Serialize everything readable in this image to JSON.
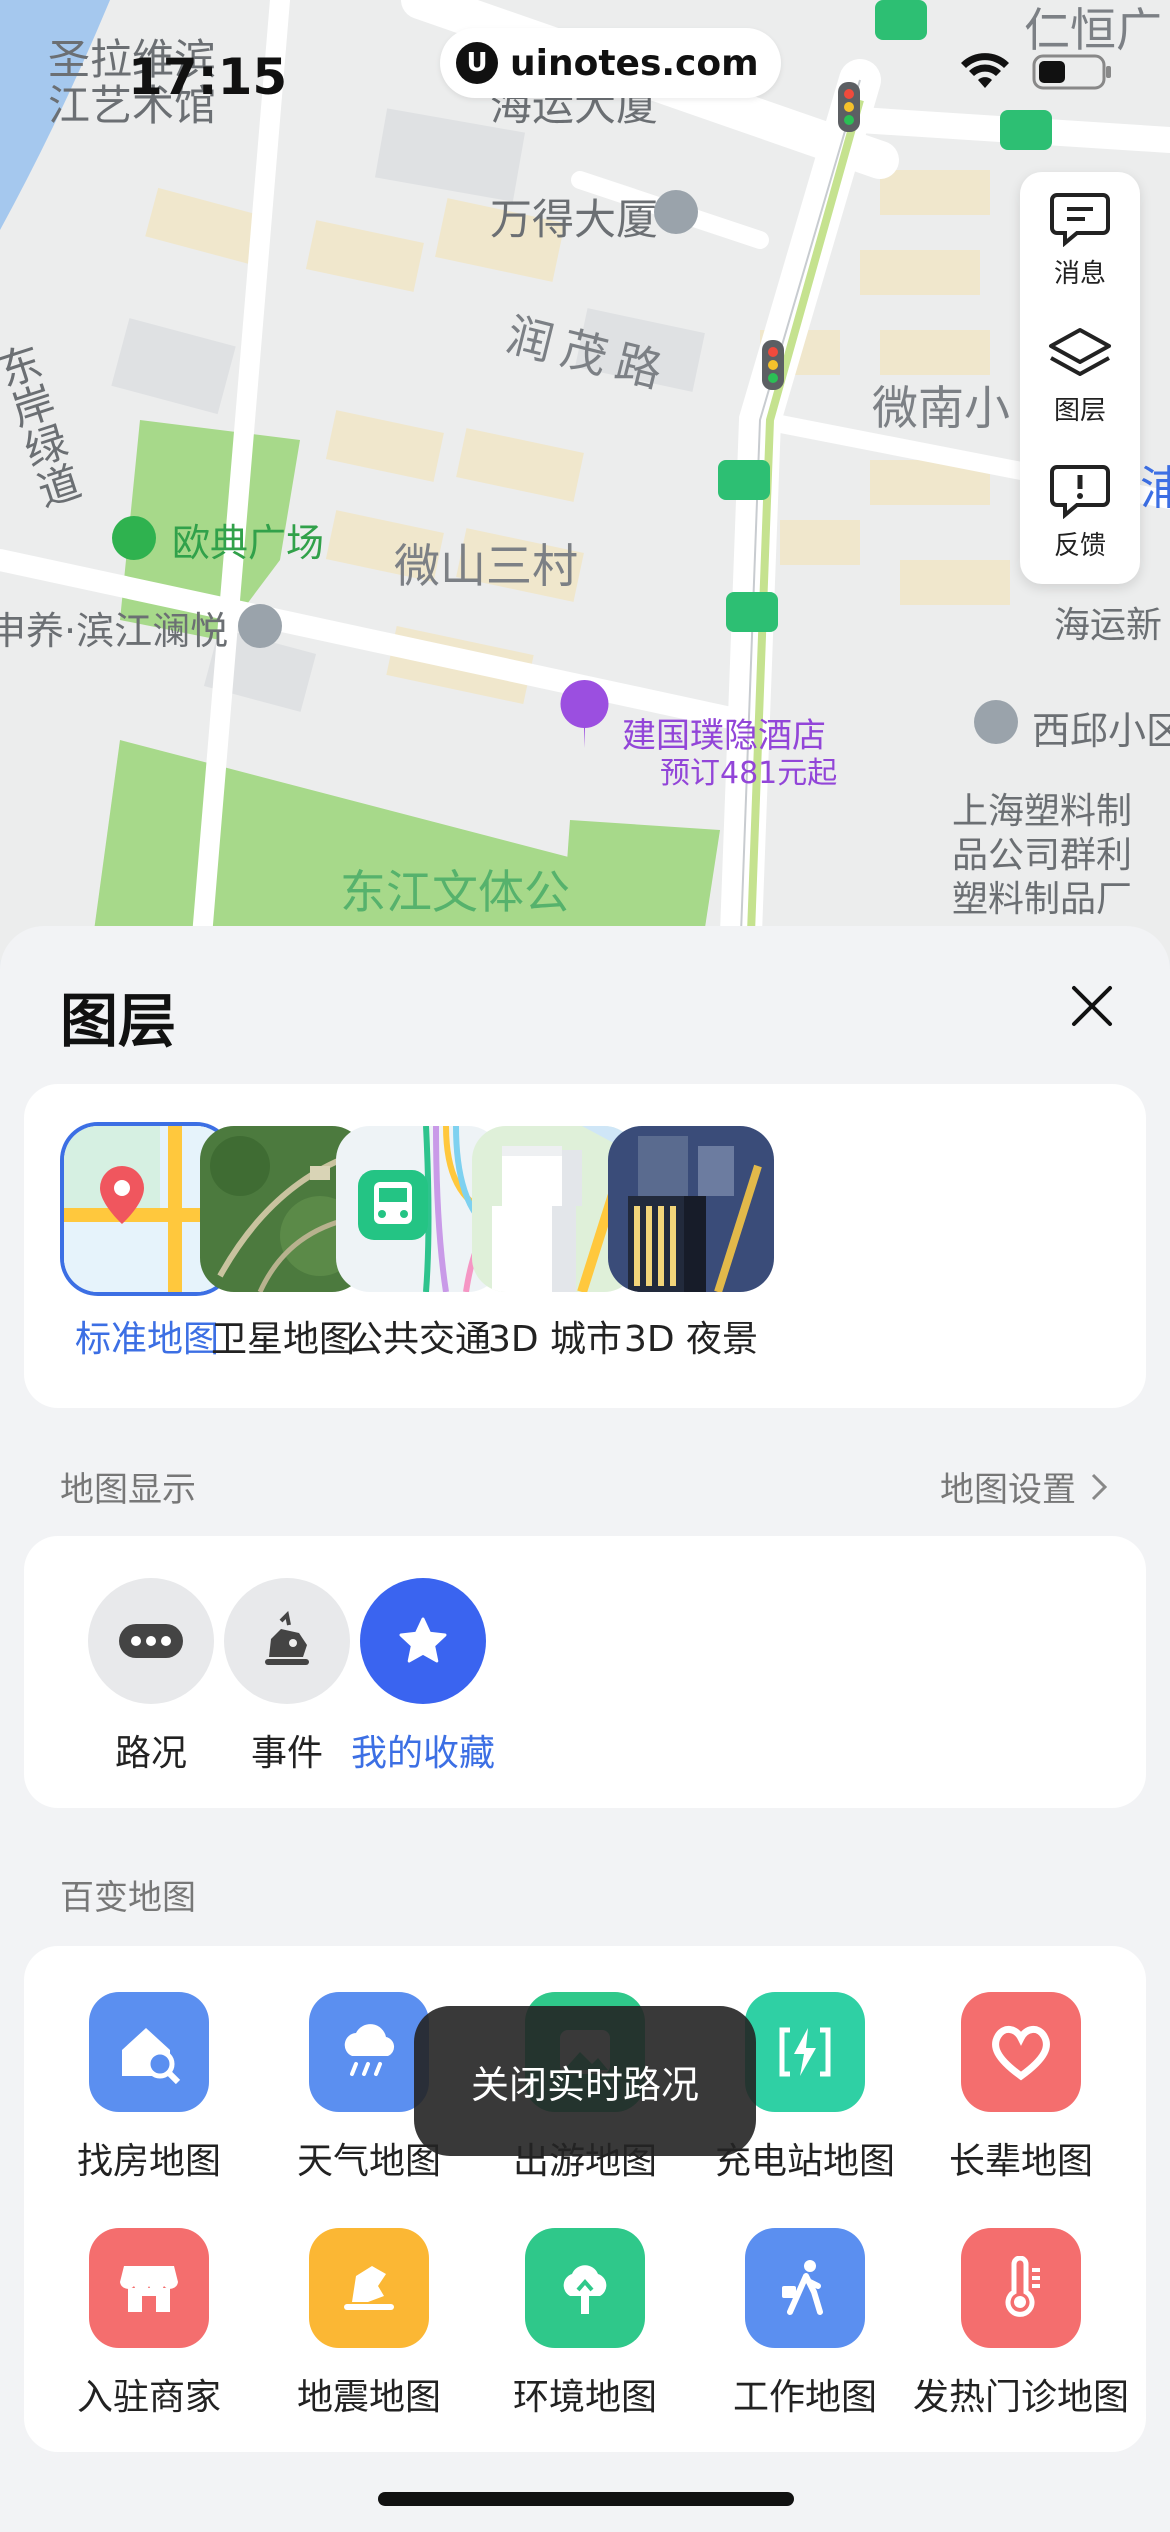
{
  "status_bar": {
    "time": "17:15",
    "url": "uinotes.com",
    "icons": [
      "wifi-icon",
      "battery-icon"
    ]
  },
  "map": {
    "labels": {
      "l1": "圣拉维滨",
      "l2": "江艺术馆",
      "l3": "海运大厦",
      "l4": "仁恒广",
      "l5": "万得大厦",
      "l6": "润茂路",
      "l7": "东岸绿道",
      "l8": "微南小",
      "l9": "欧典广场",
      "l10": "微山三村",
      "l11": "申养·滨江澜悦",
      "l12": "海运新",
      "l13": "建国璞隐酒店",
      "l14": "预订481元起",
      "l15": "西邱小区",
      "l16": "上海塑料制",
      "l17": "品公司群利",
      "l18": "塑料制品厂",
      "l19": "东江文体公",
      "l20": "浦"
    },
    "tools": {
      "messages": "消息",
      "layers": "图层",
      "feedback": "反馈"
    }
  },
  "sheet": {
    "title": "图层",
    "layers": [
      {
        "label": "标准地图",
        "selected": true
      },
      {
        "label": "卫星地图",
        "selected": false
      },
      {
        "label": "公共交通",
        "selected": false
      },
      {
        "label": "3D 城市",
        "selected": false
      },
      {
        "label": "3D 夜景",
        "selected": false
      }
    ],
    "map_display": {
      "label": "地图显示",
      "settings_link": "地图设置",
      "toggles": [
        {
          "label": "路况",
          "active": false,
          "icon": "traffic-dots-icon"
        },
        {
          "label": "事件",
          "active": false,
          "icon": "incident-icon"
        },
        {
          "label": "我的收藏",
          "active": true,
          "icon": "star-icon"
        }
      ]
    },
    "themed_maps": {
      "label": "百变地图",
      "items": [
        {
          "label": "找房地图",
          "icon": "house-search-icon",
          "color": "#5b8ff0"
        },
        {
          "label": "天气地图",
          "icon": "cloud-rain-icon",
          "color": "#5b8ff0"
        },
        {
          "label": "出游地图",
          "icon": "photo-icon",
          "color": "#2fc88a"
        },
        {
          "label": "充电站地图",
          "icon": "charging-icon",
          "color": "#2fd0a4"
        },
        {
          "label": "长辈地图",
          "icon": "heart-icon",
          "color": "#f46e6e"
        },
        {
          "label": "入驻商家",
          "icon": "shop-icon",
          "color": "#f46e6e"
        },
        {
          "label": "地震地图",
          "icon": "earthquake-icon",
          "color": "#fbb734"
        },
        {
          "label": "环境地图",
          "icon": "tree-icon",
          "color": "#2fc88a"
        },
        {
          "label": "工作地图",
          "icon": "worker-icon",
          "color": "#5b8ff0"
        },
        {
          "label": "发热门诊地图",
          "icon": "thermometer-icon",
          "color": "#f46e6e"
        }
      ]
    },
    "toast": "关闭实时路况"
  }
}
